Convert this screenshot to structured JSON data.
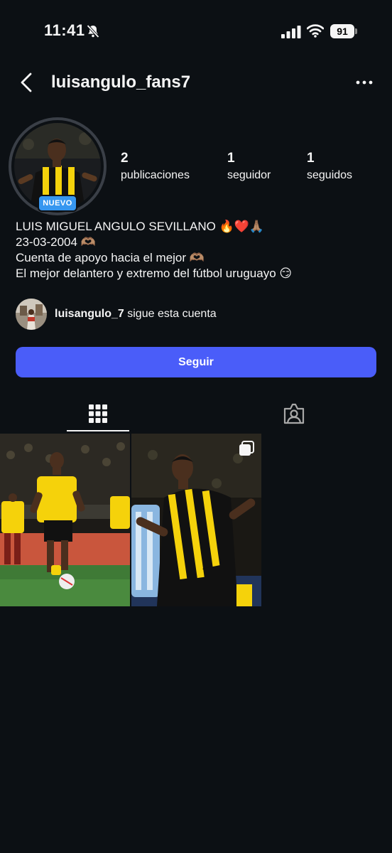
{
  "status_bar": {
    "time": "11:41",
    "battery": "91",
    "icons": [
      "bell-slash-icon",
      "signal-bars-icon",
      "wifi-icon",
      "battery-icon"
    ]
  },
  "header": {
    "username": "luisangulo_fans7",
    "icons": [
      "chevron-left-icon",
      "ellipsis-icon"
    ]
  },
  "profile": {
    "badge": "NUEVO",
    "stats": [
      {
        "value": "2",
        "label": "publicaciones"
      },
      {
        "value": "1",
        "label": "seguidor"
      },
      {
        "value": "1",
        "label": "seguidos"
      }
    ],
    "bio": [
      "LUIS MIGUEL ANGULO SEVILLANO 🔥❤️🙏🏽",
      "23-03-2004 🫶🏽",
      "Cuenta de apoyo hacia el mejor 🫶🏽",
      "El mejor delantero y extremo del fútbol uruguayo 😏"
    ]
  },
  "mention": {
    "username": "luisangulo_7",
    "text": "sigue esta cuenta"
  },
  "follow_button": "Seguir",
  "tabs": [
    {
      "name": "grid",
      "icon": "grid-icon",
      "active": true
    },
    {
      "name": "tagged",
      "icon": "tagged-person-icon",
      "active": false
    }
  ],
  "posts": [
    {
      "name": "player-training-photo",
      "carousel": false
    },
    {
      "name": "player-celebration-photo",
      "carousel": true
    }
  ],
  "colors": {
    "background": "#0c1014",
    "accent": "#4a5df9",
    "badge": "#3797f0",
    "kit_yellow": "#f5d20b"
  }
}
